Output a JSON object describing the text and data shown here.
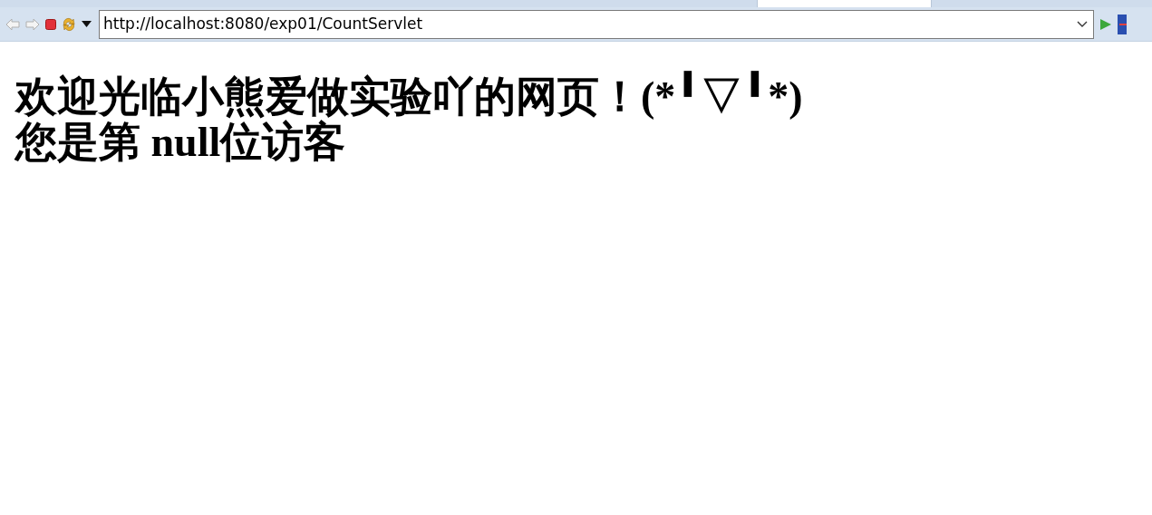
{
  "toolbar": {
    "address": "http://localhost:8080/exp01/CountServlet"
  },
  "page": {
    "lines": [
      "欢迎光临小熊爱做实验吖的网页！(*╹▽╹*)",
      "您是第 null位访客"
    ]
  }
}
